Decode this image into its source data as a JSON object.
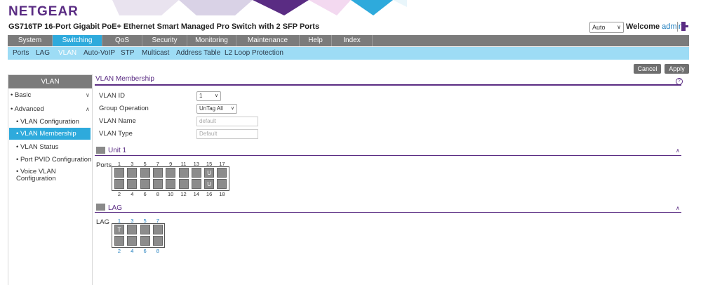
{
  "brand": {
    "logo": "NETGEAR",
    "accent": "#5a2c83",
    "nav_active": "#2eaadc"
  },
  "header": {
    "product_title": "GS716TP 16-Port Gigabit PoE+ Ethernet Smart Managed Pro Switch with 2 SFP Ports",
    "refresh_select": "Auto",
    "welcome": "Welcome",
    "user": "admin"
  },
  "main_tabs": [
    "System",
    "Switching",
    "QoS",
    "Security",
    "Monitoring",
    "Maintenance",
    "Help",
    "Index"
  ],
  "main_tab_active": "Switching",
  "sub_tabs": [
    "Ports",
    "LAG",
    "VLAN",
    "Auto-VoIP",
    "STP",
    "Multicast",
    "Address Table",
    "L2 Loop Protection"
  ],
  "sub_tab_active": "VLAN",
  "buttons": {
    "cancel": "Cancel",
    "apply": "Apply"
  },
  "sidebar": {
    "title": "VLAN",
    "basic": "Basic",
    "advanced": "Advanced",
    "items": [
      "VLAN Configuration",
      "VLAN Membership",
      "VLAN Status",
      "Port PVID Configuration",
      "Voice VLAN Configuration"
    ],
    "active_item": "VLAN Membership"
  },
  "panel": {
    "title": "VLAN Membership",
    "help_icon": "?",
    "fields": {
      "vlan_id_label": "VLAN ID",
      "vlan_id_value": "1",
      "group_op_label": "Group Operation",
      "group_op_value": "UnTag All",
      "vlan_name_label": "VLAN Name",
      "vlan_name_value": "default",
      "vlan_type_label": "VLAN Type",
      "vlan_type_value": "Default"
    }
  },
  "unit": {
    "title": "Unit 1",
    "row_label": "Ports",
    "top_numbers": [
      "1",
      "3",
      "5",
      "7",
      "9",
      "11",
      "13",
      "15",
      "17"
    ],
    "bottom_numbers": [
      "2",
      "4",
      "6",
      "8",
      "10",
      "12",
      "14",
      "16",
      "18"
    ],
    "top_marks": [
      "",
      "",
      "",
      "",
      "",
      "",
      "",
      "U",
      ""
    ],
    "bottom_marks": [
      "",
      "",
      "",
      "",
      "",
      "",
      "",
      "U",
      ""
    ]
  },
  "lag": {
    "title": "LAG",
    "row_label": "LAG",
    "top_numbers": [
      "1",
      "3",
      "5",
      "7"
    ],
    "bottom_numbers": [
      "2",
      "4",
      "6",
      "8"
    ],
    "top_marks": [
      "T",
      "",
      "",
      ""
    ],
    "bottom_marks": [
      "",
      "",
      "",
      ""
    ]
  }
}
